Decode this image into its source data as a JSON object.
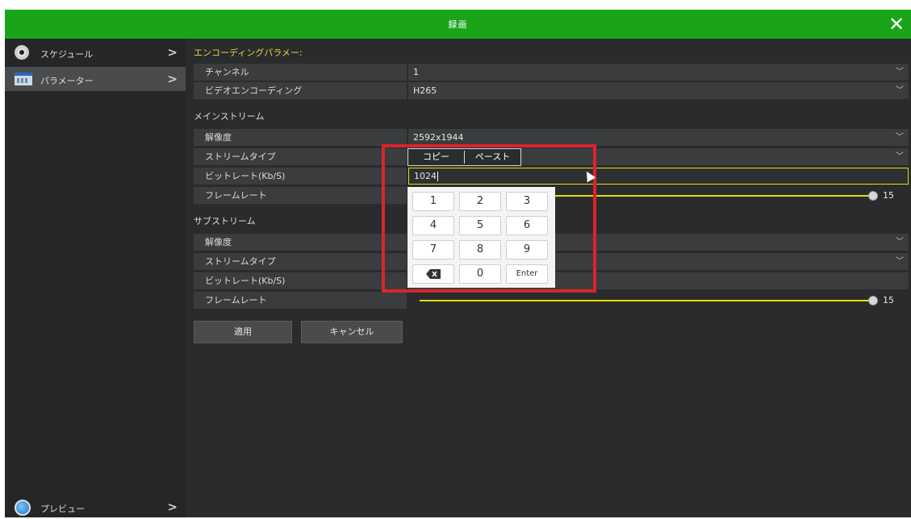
{
  "window": {
    "title": "録画"
  },
  "sidebar": {
    "items": [
      {
        "label": "スケジュール"
      },
      {
        "label": "パラメーター"
      }
    ],
    "preview": "プレビュー"
  },
  "encoding": {
    "heading": "エンコーディングパラメー:",
    "channel": {
      "label": "チャンネル",
      "value": "1"
    },
    "video_encoding": {
      "label": "ビデオエンコーディング",
      "value": "H265"
    }
  },
  "main_stream": {
    "heading": "メインストリーム",
    "resolution": {
      "label": "解像度",
      "value": "2592x1944"
    },
    "stream_type": {
      "label": "ストリームタイプ",
      "value": ""
    },
    "bitrate": {
      "label": "ビットレート(Kb/S)",
      "value": "1024"
    },
    "framerate": {
      "label": "フレームレート",
      "value": "15"
    }
  },
  "sub_stream": {
    "heading": "サブストリーム",
    "resolution": {
      "label": "解像度",
      "value": ""
    },
    "stream_type": {
      "label": "ストリームタイプ",
      "value": ""
    },
    "bitrate": {
      "label": "ビットレート(Kb/S)",
      "value": ""
    },
    "framerate": {
      "label": "フレームレート",
      "value": "15"
    }
  },
  "buttons": {
    "apply": "適用",
    "cancel": "キャンセル"
  },
  "clipboard": {
    "copy": "コピー",
    "paste": "ペースト"
  },
  "keypad": {
    "keys": [
      "1",
      "2",
      "3",
      "4",
      "5",
      "6",
      "7",
      "8",
      "9",
      "0"
    ],
    "enter": "Enter"
  },
  "colors": {
    "titlebar": "#1aa41a",
    "highlight": "#d9252b",
    "accent_yellow": "#e8e000"
  }
}
